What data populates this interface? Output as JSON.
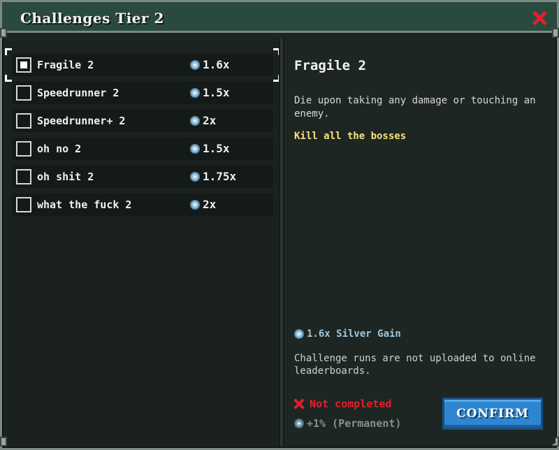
{
  "window": {
    "title": "Challenges Tier 2"
  },
  "challenges": [
    {
      "name": "Fragile 2",
      "multiplier": "1.6x",
      "selected": true
    },
    {
      "name": "Speedrunner 2",
      "multiplier": "1.5x",
      "selected": false
    },
    {
      "name": "Speedrunner+ 2",
      "multiplier": "2x",
      "selected": false
    },
    {
      "name": "oh no 2",
      "multiplier": "1.5x",
      "selected": false
    },
    {
      "name": "oh shit 2",
      "multiplier": "1.75x",
      "selected": false
    },
    {
      "name": "what the fuck 2",
      "multiplier": "2x",
      "selected": false
    }
  ],
  "detail": {
    "title": "Fragile 2",
    "description": "Die upon taking any damage or touching an enemy.",
    "goal": "Kill all the bosses",
    "silver_gain": "1.6x Silver Gain",
    "note": "Challenge runs are not uploaded to online leaderboards.",
    "status": "Not completed",
    "bonus": "+1% (Permanent)",
    "confirm_label": "CONFIRM"
  },
  "colors": {
    "accent": "#2f86d0",
    "status_fail": "#e0212a",
    "goal": "#f5e27a",
    "silver": "#9cc8e0"
  },
  "icons": {
    "close": "close-icon",
    "silver": "silver-coin-icon",
    "status": "x-icon"
  }
}
